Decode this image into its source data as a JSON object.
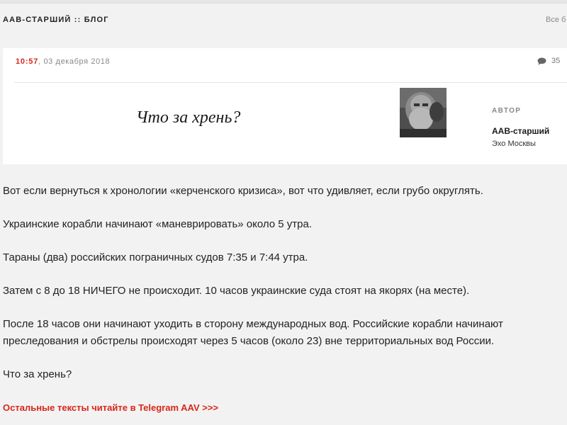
{
  "blog": {
    "title": "ААВ-СТАРШИЙ :: БЛОГ",
    "all_link": "Все б"
  },
  "post": {
    "time": "10:57",
    "date_sep": ",",
    "date": "03 декабря 2018",
    "comments_count": "35",
    "title": "Что за хрень?",
    "author_label": "АВТОР",
    "author_name": "ААВ-старший",
    "author_org": "Эхо Москвы",
    "paragraphs": [
      "Вот если вернуться к хронологии «керченского кризиса», вот что удивляет, если грубо округлять.",
      "Украинские корабли начинают «маневрировать» около 5 утра.",
      "Тараны (два) российских пограничных судов 7:35 и 7:44 утра.",
      "Затем с 8 до 18 НИЧЕГО не происходит. 10 часов украинские суда стоят на якорях (на месте).",
      "После 18 часов они начинают уходить в сторону международных вод. Российские корабли начинают преследования и обстрелы происходят через 5 часов (около 23) вне территориальных вод России.",
      "Что за хрень?"
    ],
    "telegram_link": "Остальные тексты читайте в Telegram AAV >>>"
  },
  "colors": {
    "accent": "#d8261a",
    "background": "#f2f2f2",
    "card": "#ffffff"
  },
  "icons": {
    "comments": "speech-bubble-icon"
  }
}
